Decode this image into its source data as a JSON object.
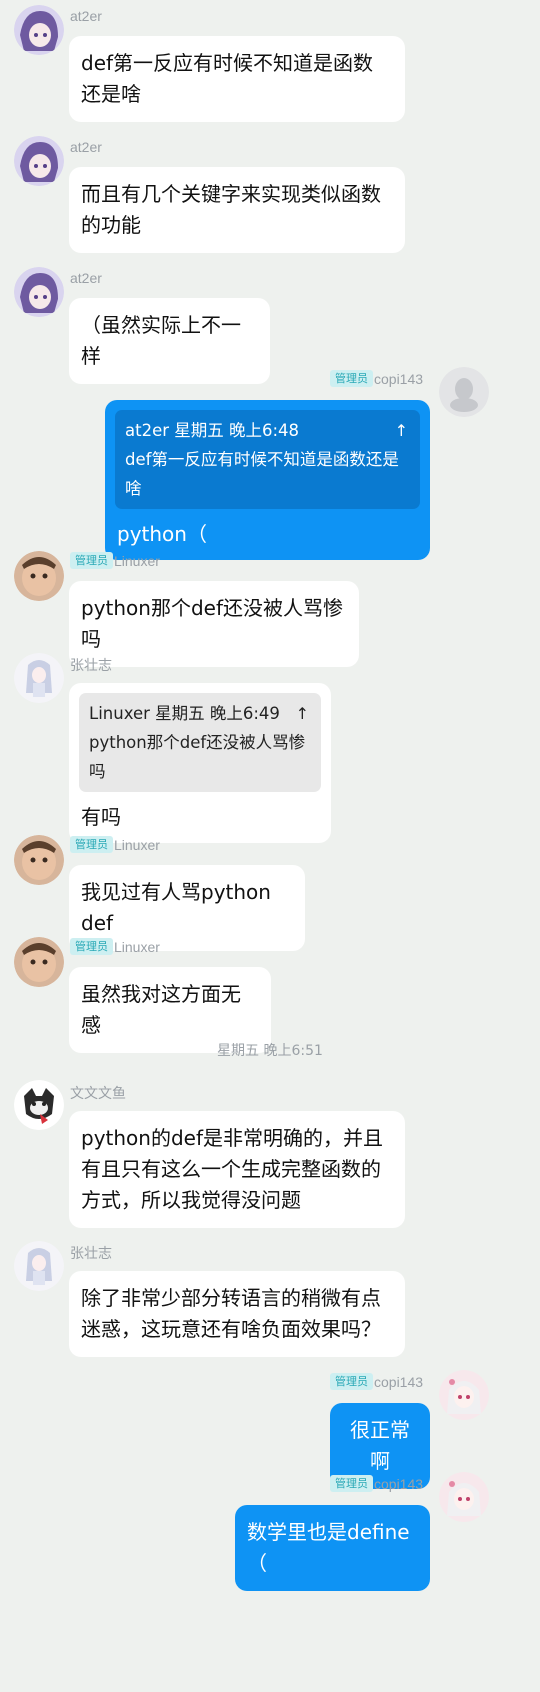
{
  "messages": [
    {
      "sender": "at2er",
      "text": "def第一反应有时候不知道是函数还是啥"
    },
    {
      "sender": "at2er",
      "text": "而且有几个关键字来实现类似函数的功能"
    },
    {
      "sender": "at2er",
      "text": "（虽然实际上不一样"
    },
    {
      "sender": "copi143",
      "badge": "管理员",
      "quote": {
        "header": "at2er 星期五 晚上6:48",
        "text": "def第一反应有时候不知道是函数还是啥"
      },
      "text": "python（"
    },
    {
      "sender": "Linuxer",
      "badge": "管理员",
      "text": "python那个def还没被人骂惨吗"
    },
    {
      "sender": "张壮志",
      "quote": {
        "header": "Linuxer 星期五 晚上6:49",
        "text": "python那个def还没被人骂惨吗"
      },
      "text": "有吗"
    },
    {
      "sender": "Linuxer",
      "badge": "管理员",
      "text": "我见过有人骂python def"
    },
    {
      "sender": "Linuxer",
      "badge": "管理员",
      "text": "虽然我对这方面无感"
    },
    {
      "sender": "文文文鱼",
      "text": "python的def是非常明确的，并且有且只有这么一个生成完整函数的方式，所以我觉得没问题"
    },
    {
      "sender": "张壮志",
      "text": "除了非常少部分转语言的稍微有点迷惑，这玩意还有啥负面效果吗？"
    },
    {
      "sender": "copi143",
      "badge": "管理员",
      "text": "很正常啊"
    },
    {
      "sender": "copi143",
      "badge": "管理员",
      "text": "数学里也是define（"
    }
  ],
  "time_separator": "星期五 晚上6:51",
  "icons": {
    "quote_jump": "↑"
  },
  "colors": {
    "background": "#eef1ee",
    "my_bubble": "#0e93f4",
    "badge_bg": "#cdeff1",
    "badge_text": "#2aa9b6"
  }
}
